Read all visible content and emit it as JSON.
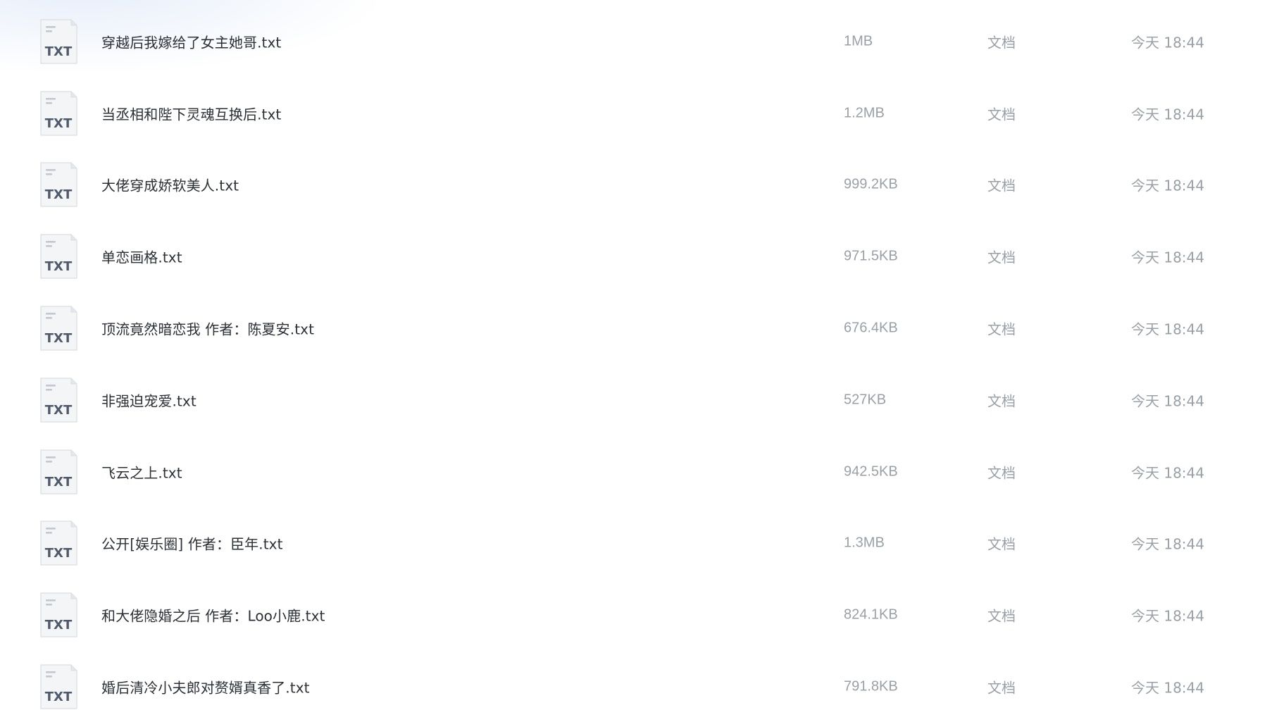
{
  "files": [
    {
      "name": "穿越后我嫁给了女主她哥.txt",
      "size": "1MB",
      "type": "文档",
      "modified": "今天 18:44",
      "icon_label": "TXT",
      "icon": "txt-file-icon"
    },
    {
      "name": "当丞相和陛下灵魂互换后.txt",
      "size": "1.2MB",
      "type": "文档",
      "modified": "今天 18:44",
      "icon_label": "TXT",
      "icon": "txt-file-icon"
    },
    {
      "name": "大佬穿成娇软美人.txt",
      "size": "999.2KB",
      "type": "文档",
      "modified": "今天 18:44",
      "icon_label": "TXT",
      "icon": "txt-file-icon"
    },
    {
      "name": "单恋画格.txt",
      "size": "971.5KB",
      "type": "文档",
      "modified": "今天 18:44",
      "icon_label": "TXT",
      "icon": "txt-file-icon"
    },
    {
      "name": "顶流竟然暗恋我 作者：陈夏安.txt",
      "size": "676.4KB",
      "type": "文档",
      "modified": "今天 18:44",
      "icon_label": "TXT",
      "icon": "txt-file-icon"
    },
    {
      "name": "非强迫宠爱.txt",
      "size": "527KB",
      "type": "文档",
      "modified": "今天 18:44",
      "icon_label": "TXT",
      "icon": "txt-file-icon"
    },
    {
      "name": "飞云之上.txt",
      "size": "942.5KB",
      "type": "文档",
      "modified": "今天 18:44",
      "icon_label": "TXT",
      "icon": "txt-file-icon"
    },
    {
      "name": "公开[娱乐圈] 作者：臣年.txt",
      "size": "1.3MB",
      "type": "文档",
      "modified": "今天 18:44",
      "icon_label": "TXT",
      "icon": "txt-file-icon"
    },
    {
      "name": "和大佬隐婚之后 作者：Loo小鹿.txt",
      "size": "824.1KB",
      "type": "文档",
      "modified": "今天 18:44",
      "icon_label": "TXT",
      "icon": "txt-file-icon"
    },
    {
      "name": "婚后清冷小夫郎对赘婿真香了.txt",
      "size": "791.8KB",
      "type": "文档",
      "modified": "今天 18:44",
      "icon_label": "TXT",
      "icon": "txt-file-icon"
    }
  ],
  "colors": {
    "name_text": "#2b2f36",
    "meta_text": "#9aa0a8",
    "icon_paper": "#f4f5f7",
    "icon_label": "#4e5969"
  }
}
